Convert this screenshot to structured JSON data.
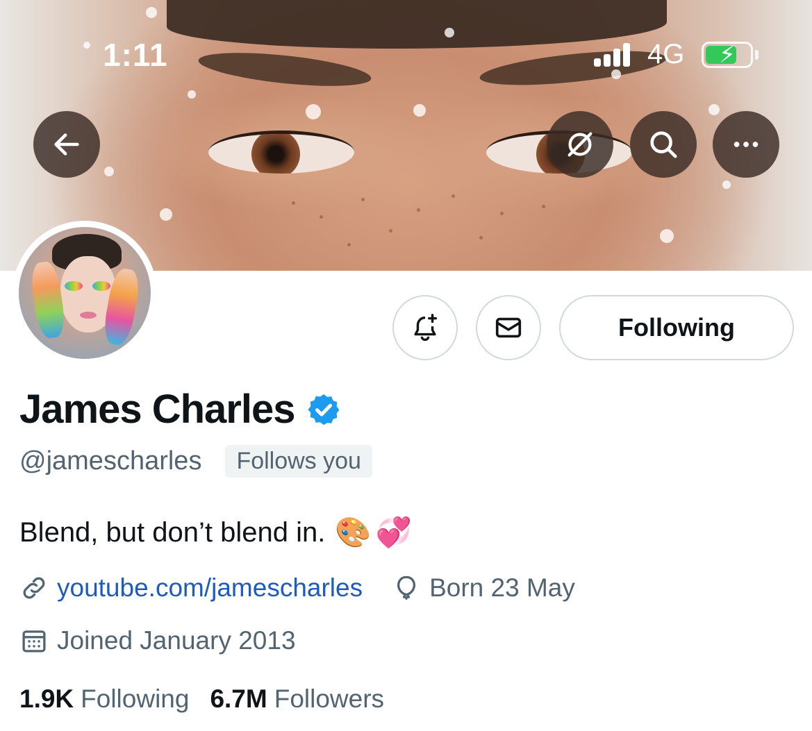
{
  "status_bar": {
    "time": "1:11",
    "network": "4G",
    "battery_charging": true,
    "battery_color": "#34c759"
  },
  "header": {
    "back_icon": "arrow-left-icon",
    "translate_icon": "translate-off-icon",
    "search_icon": "search-icon",
    "more_icon": "more-horizontal-icon"
  },
  "profile": {
    "name": "James Charles",
    "verified": true,
    "verified_color": "#1d9bf0",
    "handle": "@jamescharles",
    "follows_you": "Follows you",
    "bio_text": "Blend, but don’t blend in.",
    "bio_emoji": [
      "🎨",
      "💞"
    ],
    "website": "youtube.com/jamescharles",
    "birthday": "Born 23 May",
    "joined": "Joined January 2013"
  },
  "actions": {
    "notify_icon": "bell-plus-icon",
    "message_icon": "envelope-icon",
    "following_label": "Following"
  },
  "stats": {
    "following_count": "1.9K",
    "following_label": "Following",
    "followers_count": "6.7M",
    "followers_label": "Followers"
  }
}
